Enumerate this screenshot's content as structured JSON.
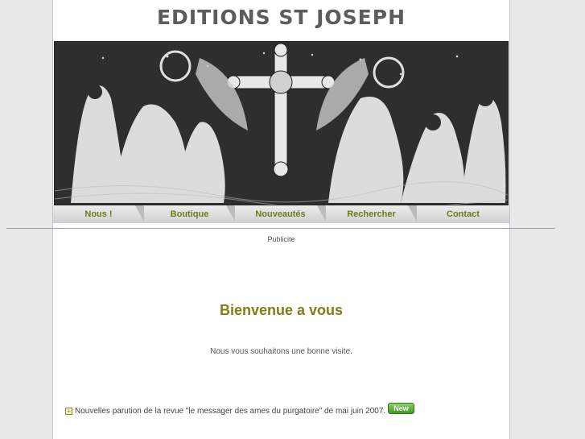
{
  "site": {
    "title": "EDITIONS ST JOSEPH"
  },
  "nav": [
    {
      "label": "Nous !"
    },
    {
      "label": "Boutique"
    },
    {
      "label": "Nouveautés"
    },
    {
      "label": "Rechercher"
    },
    {
      "label": "Contact"
    }
  ],
  "ad": {
    "label": "Publicite"
  },
  "main": {
    "heading": "Bienvenue a vous",
    "subtext": "Nous vous souhaitons une bonne visite.",
    "news_item": "Nouvelles parution de la revue \"le messager des ames du purgatoire\" de mai juin 2007.",
    "new_badge": "New"
  },
  "colors": {
    "accent": "#7d7f14",
    "nav_text": "#6a7d14",
    "title": "#5c5c5c"
  }
}
